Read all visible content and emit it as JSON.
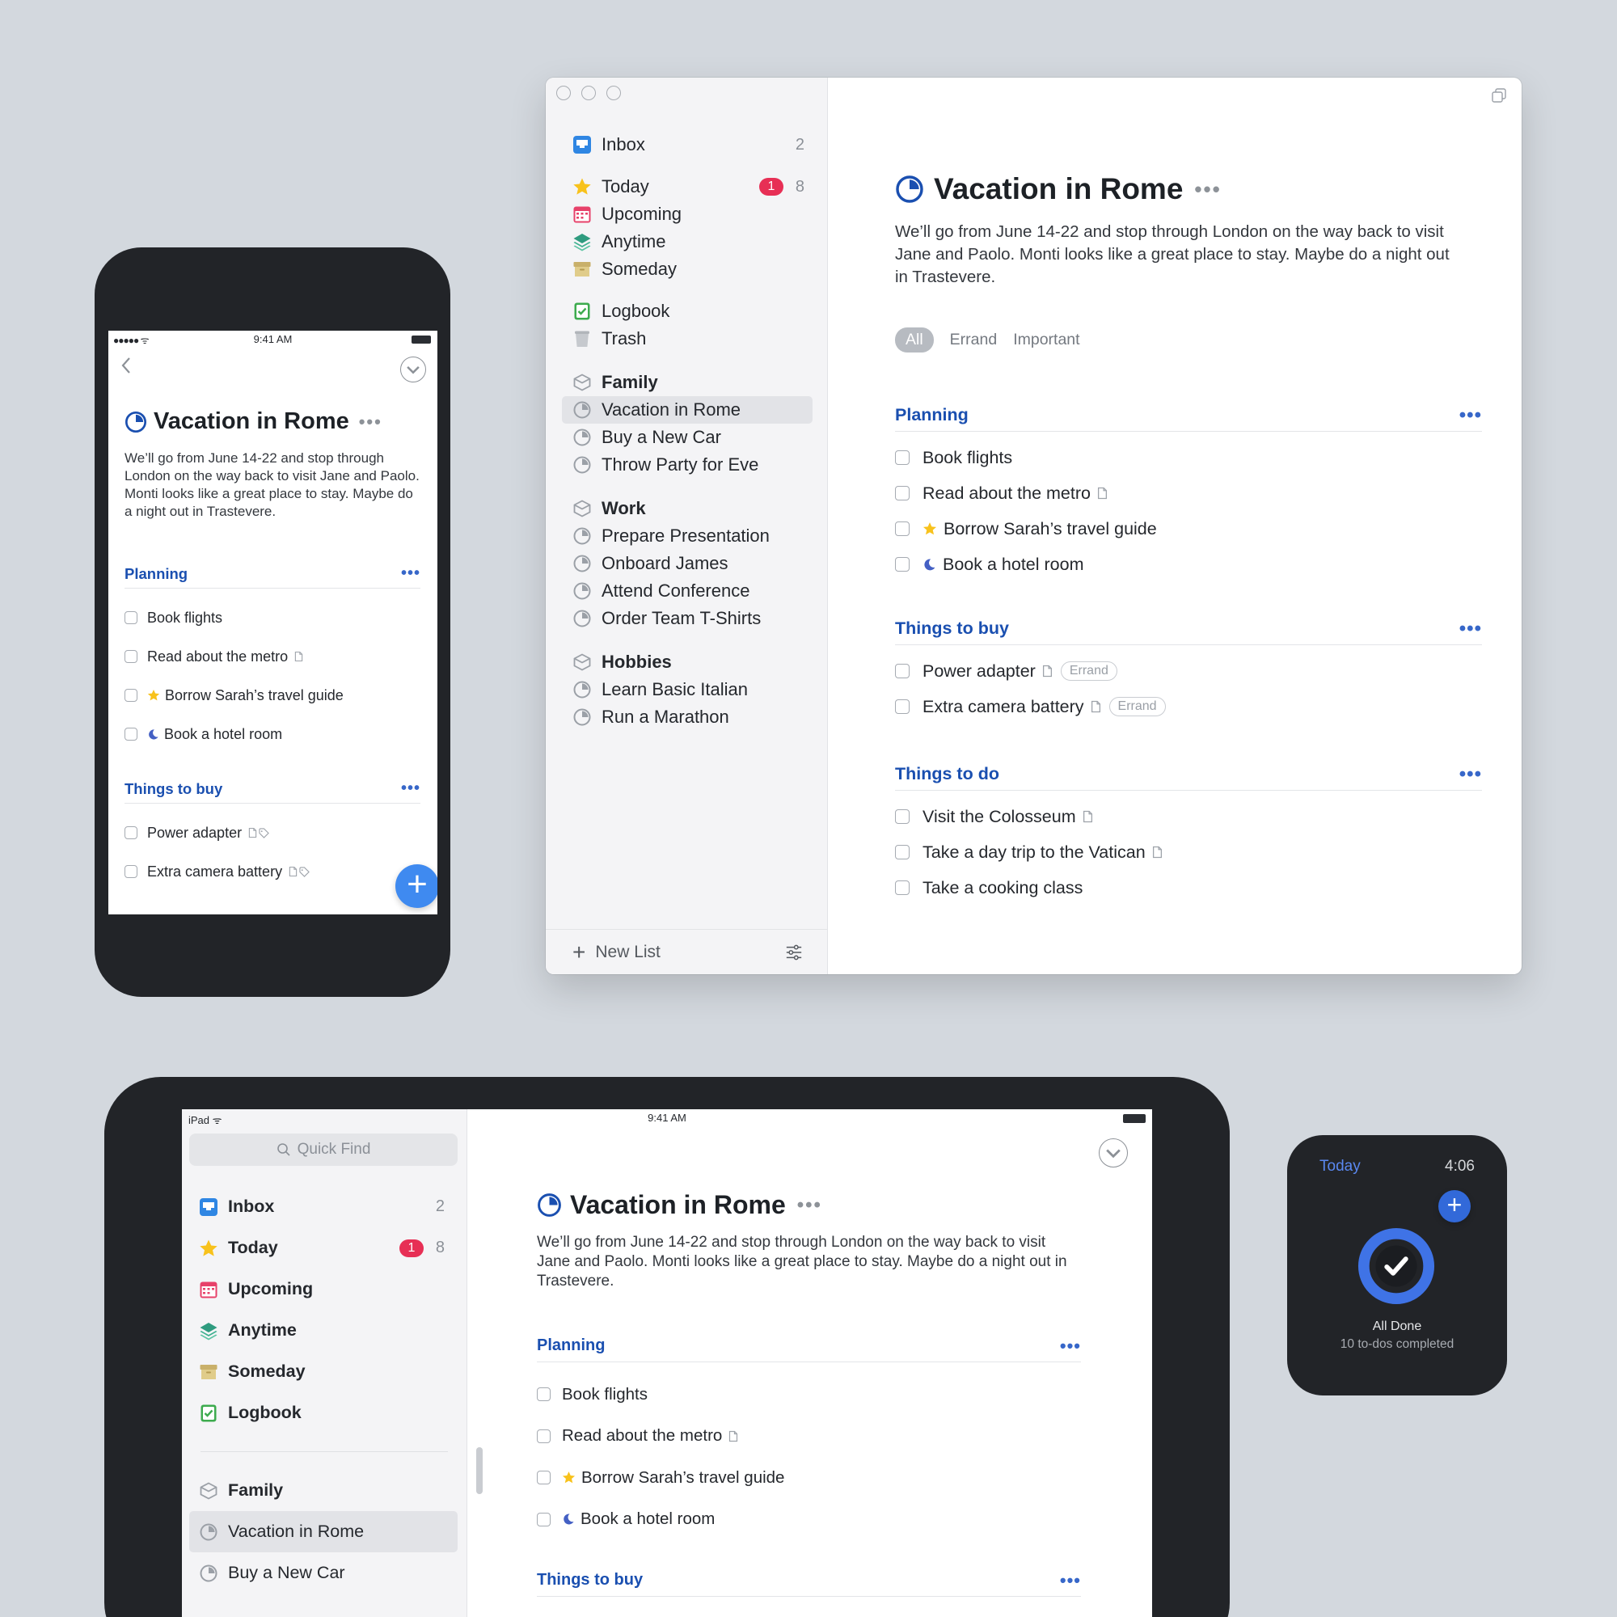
{
  "mac": {
    "nav": {
      "inbox": {
        "label": "Inbox",
        "count": "2"
      },
      "today": {
        "label": "Today",
        "badge": "1",
        "count": "8"
      },
      "upcoming": "Upcoming",
      "anytime": "Anytime",
      "someday": "Someday",
      "logbook": "Logbook",
      "trash": "Trash",
      "areas": [
        {
          "name": "Family",
          "projects": [
            "Vacation in Rome",
            "Buy a New Car",
            "Throw Party for Eve"
          ]
        },
        {
          "name": "Work",
          "projects": [
            "Prepare Presentation",
            "Onboard James",
            "Attend Conference",
            "Order Team T-Shirts"
          ]
        },
        {
          "name": "Hobbies",
          "projects": [
            "Learn Basic Italian",
            "Run a Marathon"
          ]
        }
      ]
    },
    "new_list": "New List",
    "filters": [
      "All",
      "Errand",
      "Important"
    ]
  },
  "project": {
    "title": "Vacation in Rome",
    "more": "•••",
    "notes": "We’ll go from June 14-22 and stop through London on the way back to visit Jane and Paolo. Monti looks like a great place to stay. Maybe do a night out in Trastevere.",
    "sections": [
      {
        "title": "Planning",
        "todos": [
          {
            "text": "Book flights"
          },
          {
            "text": "Read about the metro"
          },
          {
            "text": "Borrow Sarah’s travel guide"
          },
          {
            "text": "Book a hotel room"
          }
        ]
      },
      {
        "title": "Things to buy",
        "todos": [
          {
            "text": "Power adapter",
            "tag": "Errand"
          },
          {
            "text": "Extra camera battery",
            "tag": "Errand"
          }
        ]
      },
      {
        "title": "Things to do",
        "todos": [
          {
            "text": "Visit the Colosseum"
          },
          {
            "text": "Take a day trip to the Vatican"
          },
          {
            "text": "Take a cooking class"
          }
        ]
      }
    ]
  },
  "phone": {
    "time": "9:41 AM",
    "signal": "●●●●● ᯤ"
  },
  "ipad": {
    "status_left": "iPad ᯤ",
    "time": "9:41 AM",
    "search_placeholder": "Quick Find",
    "nav": {
      "inbox": "Inbox",
      "inbox_count": "2",
      "today": "Today",
      "today_badge": "1",
      "today_count": "8",
      "upcoming": "Upcoming",
      "anytime": "Anytime",
      "someday": "Someday",
      "logbook": "Logbook",
      "family": "Family",
      "vacation": "Vacation in Rome",
      "car": "Buy a New Car"
    }
  },
  "watch": {
    "title": "Today",
    "time": "4:06",
    "done": "All Done",
    "subtitle": "10 to-dos completed"
  },
  "colors": {
    "accent": "#1a4fb0",
    "badge": "#e72f55",
    "fab": "#3f8af0",
    "today_star": "#f8c21c"
  }
}
